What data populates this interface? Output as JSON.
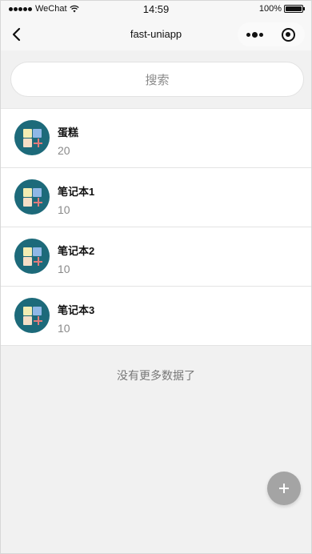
{
  "status_bar": {
    "carrier": "WeChat",
    "time": "14:59",
    "battery_text": "100%",
    "battery_level": 1.0
  },
  "nav": {
    "title": "fast-uniapp",
    "back_icon": "chevron-left-icon",
    "more_icon": "more-dots-icon",
    "close_icon": "target-icon"
  },
  "search": {
    "placeholder": "搜索"
  },
  "items": [
    {
      "name": "蛋糕",
      "count": "20"
    },
    {
      "name": "笔记本1",
      "count": "10"
    },
    {
      "name": "笔记本2",
      "count": "10"
    },
    {
      "name": "笔记本3",
      "count": "10"
    }
  ],
  "footer": {
    "no_more_text": "没有更多数据了"
  },
  "fab": {
    "icon": "plus-icon",
    "color": "#a4a4a4"
  },
  "colors": {
    "avatar_bg": "#1d6a7a",
    "page_bg": "#f1f1f1"
  }
}
